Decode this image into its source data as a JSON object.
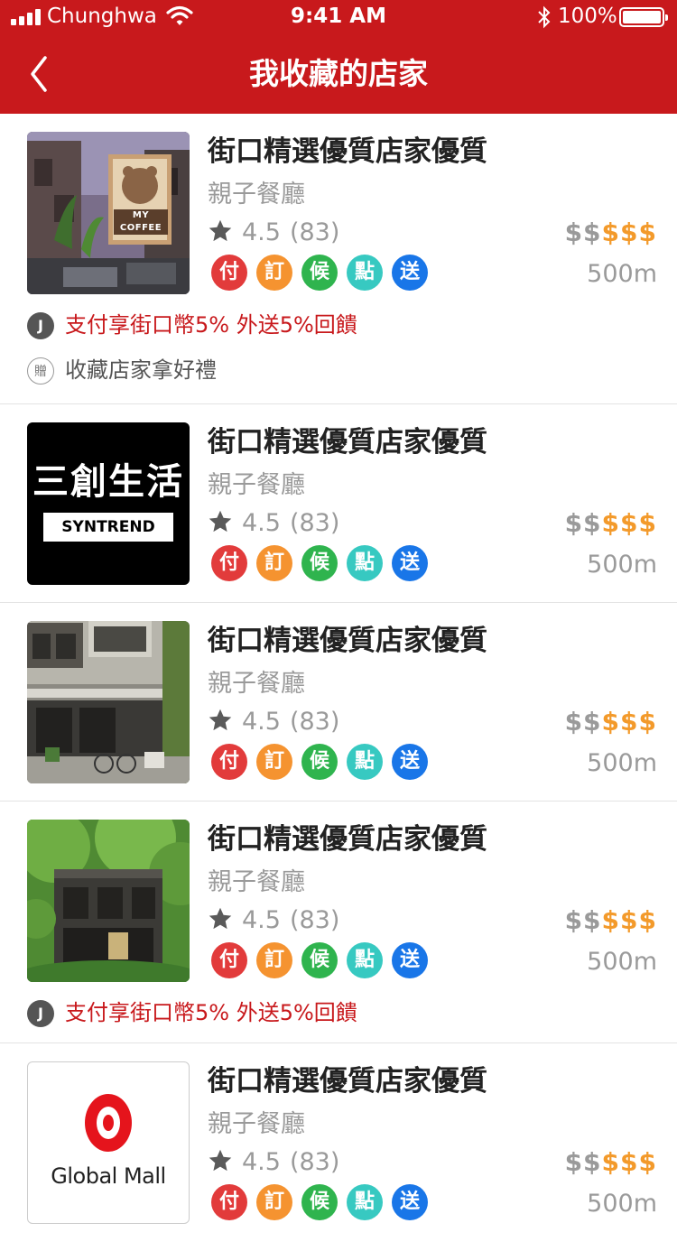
{
  "status_bar": {
    "carrier": "Chunghwa",
    "time": "9:41 AM",
    "battery": "100%"
  },
  "header": {
    "title": "我收藏的店家"
  },
  "badge_colors": [
    "#e23b3b",
    "#f59330",
    "#2fb44e",
    "#37c9c1",
    "#1976e8"
  ],
  "stores": [
    {
      "name": "街口精選優質店家優質",
      "category": "親子餐廳",
      "rating": "4.5",
      "reviews": "(83)",
      "price_dim": "$$",
      "price_hot": "$$$",
      "distance": "500m",
      "badges": [
        "付",
        "訂",
        "候",
        "點",
        "送"
      ],
      "image_text": "MY COFFEE",
      "promos": [
        {
          "icon": "J",
          "text": "支付享街口幣5% 外送5%回饋"
        },
        {
          "icon": "贈",
          "text": "收藏店家拿好禮"
        }
      ]
    },
    {
      "name": "街口精選優質店家優質",
      "category": "親子餐廳",
      "rating": "4.5",
      "reviews": "(83)",
      "price_dim": "$$",
      "price_hot": "$$$",
      "distance": "500m",
      "badges": [
        "付",
        "訂",
        "候",
        "點",
        "送"
      ],
      "image_text": "三創生活",
      "image_subtext": "SYNTREND"
    },
    {
      "name": "街口精選優質店家優質",
      "category": "親子餐廳",
      "rating": "4.5",
      "reviews": "(83)",
      "price_dim": "$$",
      "price_hot": "$$$",
      "distance": "500m",
      "badges": [
        "付",
        "訂",
        "候",
        "點",
        "送"
      ]
    },
    {
      "name": "街口精選優質店家優質",
      "category": "親子餐廳",
      "rating": "4.5",
      "reviews": "(83)",
      "price_dim": "$$",
      "price_hot": "$$$",
      "distance": "500m",
      "badges": [
        "付",
        "訂",
        "候",
        "點",
        "送"
      ],
      "promos": [
        {
          "icon": "J",
          "text": "支付享街口幣5% 外送5%回饋"
        }
      ]
    },
    {
      "name": "街口精選優質店家優質",
      "category": "親子餐廳",
      "rating": "4.5",
      "reviews": "(83)",
      "price_dim": "$$",
      "price_hot": "$$$",
      "distance": "500m",
      "badges": [
        "付",
        "訂",
        "候",
        "點",
        "送"
      ],
      "image_text": "Global Mall"
    }
  ]
}
